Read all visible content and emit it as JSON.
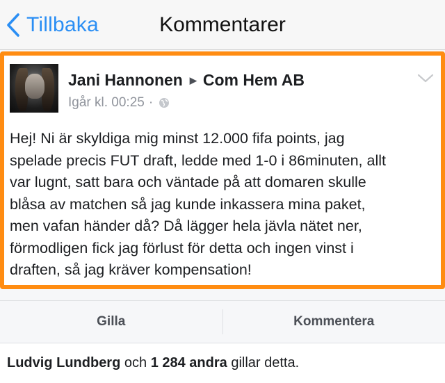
{
  "nav": {
    "back_label": "Tillbaka",
    "title": "Kommentarer",
    "accent_color": "#2a8ef4"
  },
  "post": {
    "highlight_color": "#ff8c12",
    "author": "Jani Hannonen",
    "target": "Com Hem AB",
    "timestamp": "Igår kl. 00:25",
    "separator": "·",
    "privacy_icon": "globe-icon",
    "menu_icon": "chevron-down-icon",
    "text": "Hej! Ni är skyldiga mig minst 12.000 fifa points, jag\nspelade precis FUT draft, ledde med 1-0 i 86minuten, allt\nvar lugnt, satt bara och väntade på att domaren skulle\nblåsa av matchen så jag kunde inkassera mina paket,\nmen vafan händer då? Då lägger hela jävla nätet ner,\nförmodligen fick jag förlust för detta och ingen vinst i\ndraften, så jag kräver kompensation!"
  },
  "actions": {
    "like_label": "Gilla",
    "comment_label": "Kommentera"
  },
  "likes": {
    "first_name": "Ludvig Lundberg",
    "and_word": "och",
    "others_count": "1 284 andra",
    "suffix": "gillar detta."
  }
}
